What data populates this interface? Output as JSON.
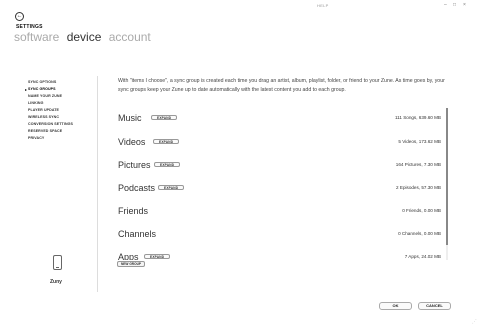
{
  "window": {
    "help_label": "HELP",
    "minimize_glyph": "–",
    "maximize_glyph": "□",
    "close_glyph": "×"
  },
  "header": {
    "back_glyph": "←",
    "title": "SETTINGS",
    "tabs": [
      {
        "label": "software",
        "active": false
      },
      {
        "label": "device",
        "active": true
      },
      {
        "label": "account",
        "active": false
      }
    ]
  },
  "sidebar": {
    "items": [
      {
        "label": "SYNC OPTIONS",
        "selected": false
      },
      {
        "label": "SYNC GROUPS",
        "selected": true
      },
      {
        "label": "NAME YOUR ZUNE",
        "selected": false
      },
      {
        "label": "LINKING",
        "selected": false
      },
      {
        "label": "PLAYER UPDATE",
        "selected": false
      },
      {
        "label": "WIRELESS SYNC",
        "selected": false
      },
      {
        "label": "CONVERSION SETTINGS",
        "selected": false
      },
      {
        "label": "RESERVED SPACE",
        "selected": false
      },
      {
        "label": "PRIVACY",
        "selected": false
      }
    ],
    "device_name": "Zuny"
  },
  "main": {
    "intro": "With \"items I choose\", a sync group is created each time you drag an artist, album, playlist, folder, or friend to your Zune. As time goes by, your sync groups keep your Zune up to date automatically with the latest content you add to each group.",
    "expand_label": "EXPAND",
    "groups": [
      {
        "name": "Music",
        "summary": "111 Songs, 639.60 MB",
        "has_expand": true
      },
      {
        "name": "Videos",
        "summary": "5 Videos, 173.62 MB",
        "has_expand": true
      },
      {
        "name": "Pictures",
        "summary": "164 Pictures, 7.30 MB",
        "has_expand": true
      },
      {
        "name": "Podcasts",
        "summary": "2 Episodes, 57.30 MB",
        "has_expand": true
      },
      {
        "name": "Friends",
        "summary": "0 Friends, 0.00 MB",
        "has_expand": false
      },
      {
        "name": "Channels",
        "summary": "0 Channels, 0.00 MB",
        "has_expand": false
      },
      {
        "name": "Apps",
        "summary": "7 Apps, 24.02 MB",
        "has_expand": true
      }
    ],
    "new_group_label": "NEW GROUP"
  },
  "footer": {
    "ok_label": "OK",
    "cancel_label": "CANCEL"
  }
}
